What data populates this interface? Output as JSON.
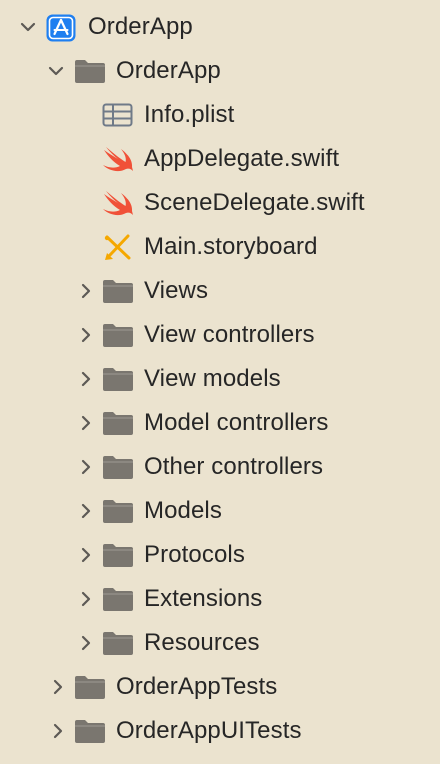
{
  "navigator": {
    "rows": [
      {
        "label": "OrderApp",
        "icon": "xcode-project-icon",
        "disclosure": "expanded"
      },
      {
        "label": "OrderApp",
        "icon": "folder-icon",
        "disclosure": "expanded"
      },
      {
        "label": "Info.plist",
        "icon": "plist-icon",
        "disclosure": "none"
      },
      {
        "label": "AppDelegate.swift",
        "icon": "swift-icon",
        "disclosure": "none"
      },
      {
        "label": "SceneDelegate.swift",
        "icon": "swift-icon",
        "disclosure": "none"
      },
      {
        "label": "Main.storyboard",
        "icon": "storyboard-icon",
        "disclosure": "none"
      },
      {
        "label": "Views",
        "icon": "folder-icon",
        "disclosure": "collapsed"
      },
      {
        "label": "View controllers",
        "icon": "folder-icon",
        "disclosure": "collapsed"
      },
      {
        "label": "View models",
        "icon": "folder-icon",
        "disclosure": "collapsed"
      },
      {
        "label": "Model controllers",
        "icon": "folder-icon",
        "disclosure": "collapsed"
      },
      {
        "label": "Other controllers",
        "icon": "folder-icon",
        "disclosure": "collapsed"
      },
      {
        "label": "Models",
        "icon": "folder-icon",
        "disclosure": "collapsed"
      },
      {
        "label": "Protocols",
        "icon": "folder-icon",
        "disclosure": "collapsed"
      },
      {
        "label": "Extensions",
        "icon": "folder-icon",
        "disclosure": "collapsed"
      },
      {
        "label": "Resources",
        "icon": "folder-icon",
        "disclosure": "collapsed"
      },
      {
        "label": "OrderAppTests",
        "icon": "folder-icon",
        "disclosure": "collapsed"
      },
      {
        "label": "OrderAppUITests",
        "icon": "folder-icon",
        "disclosure": "collapsed"
      }
    ]
  },
  "colors": {
    "background": "#ebe3cf",
    "text": "#262626",
    "folder": "#7a766f",
    "chevron": "#5d5a55",
    "swift": "#f05138",
    "project": "#1f7ff0",
    "storyboard": "#f5a800"
  }
}
